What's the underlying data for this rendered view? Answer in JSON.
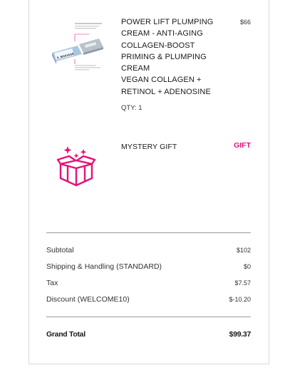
{
  "items": [
    {
      "name_lines": [
        "POWER LIFT PLUMPING",
        "CREAM - ANTI-AGING",
        "COLLAGEN-BOOST",
        "PRIMING & PLUMPING",
        "CREAM"
      ],
      "subtitle_lines": [
        "VEGAN COLLAGEN +",
        "RETINOL + ADENOSINE"
      ],
      "price": "$66",
      "qty": "QTY: 1",
      "image_brand": "IL MAKIAGE",
      "image_icon": "cream-tube-product-image"
    },
    {
      "name": "MYSTERY GIFT",
      "tag": "GIFT",
      "image_icon": "gift-box-icon",
      "accent": "#e5117a"
    }
  ],
  "summary": {
    "subtotal_label": "Subtotal",
    "subtotal_value": "$102",
    "shipping_label": "Shipping & Handling (STANDARD)",
    "shipping_value": "$0",
    "tax_label": "Tax",
    "tax_value": "$7.57",
    "discount_label": "Discount (WELCOME10)",
    "discount_value": "$-10.20",
    "grand_total_label": "Grand Total",
    "grand_total_value": "$99.37"
  }
}
